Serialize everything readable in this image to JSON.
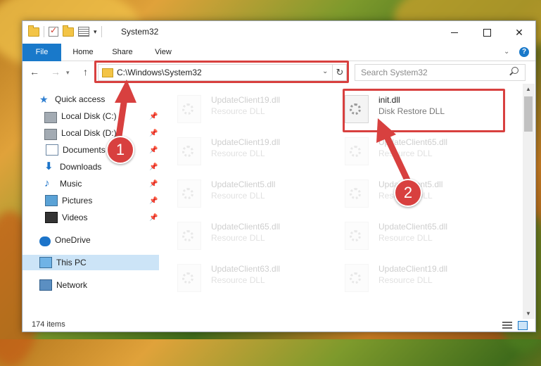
{
  "window": {
    "title": "System32",
    "controls": {
      "minimize": "minimize-icon",
      "maximize": "maximize-icon",
      "close": "close-icon"
    }
  },
  "ribbon": {
    "tabs": [
      "File",
      "Home",
      "Share",
      "View"
    ],
    "help": "?"
  },
  "navigation": {
    "address": "C:\\Windows\\System32",
    "search_placeholder": "Search System32"
  },
  "sidebar": {
    "items": [
      {
        "label": "Quick access",
        "icon": "star-icon",
        "pinned": false
      },
      {
        "label": "Local Disk (C:)",
        "icon": "drive-icon",
        "pinned": true
      },
      {
        "label": "Local Disk (D:)",
        "icon": "drive-icon",
        "pinned": true
      },
      {
        "label": "Documents",
        "icon": "documents-icon",
        "pinned": true
      },
      {
        "label": "Downloads",
        "icon": "download-icon",
        "pinned": true
      },
      {
        "label": "Music",
        "icon": "music-icon",
        "pinned": true
      },
      {
        "label": "Pictures",
        "icon": "pictures-icon",
        "pinned": true
      },
      {
        "label": "Videos",
        "icon": "videos-icon",
        "pinned": true
      },
      {
        "label": "OneDrive",
        "icon": "cloud-icon",
        "pinned": false
      },
      {
        "label": "This PC",
        "icon": "computer-icon",
        "pinned": false,
        "selected": true
      },
      {
        "label": "Network",
        "icon": "network-icon",
        "pinned": false
      }
    ]
  },
  "files": [
    {
      "name": "UpdateClient19.dll",
      "type": "Resource DLL",
      "faded": true
    },
    {
      "name": "init.dll",
      "type": "Disk Restore DLL",
      "faded": false,
      "highlighted": true
    },
    {
      "name": "UpdateClient19.dll",
      "type": "Resource DLL",
      "faded": true
    },
    {
      "name": "UpdateClient65.dll",
      "type": "Resource DLL",
      "faded": true
    },
    {
      "name": "UpdateClient5.dll",
      "type": "Resource DLL",
      "faded": true
    },
    {
      "name": "UpdateClient5.dll",
      "type": "Resource DLL",
      "faded": true
    },
    {
      "name": "UpdateClient65.dll",
      "type": "Resource DLL",
      "faded": true
    },
    {
      "name": "UpdateClient65.dll",
      "type": "Resource DLL",
      "faded": true
    },
    {
      "name": "UpdateClient63.dll",
      "type": "Resource DLL",
      "faded": true
    },
    {
      "name": "UpdateClient19.dll",
      "type": "Resource DLL",
      "faded": true
    }
  ],
  "status": {
    "item_count": "174 items"
  },
  "annotations": {
    "step1": "1",
    "step2": "2",
    "color": "#d8403f"
  },
  "colors": {
    "accent": "#1979ca",
    "selection": "#cce4f7",
    "highlight": "#d8403f"
  }
}
